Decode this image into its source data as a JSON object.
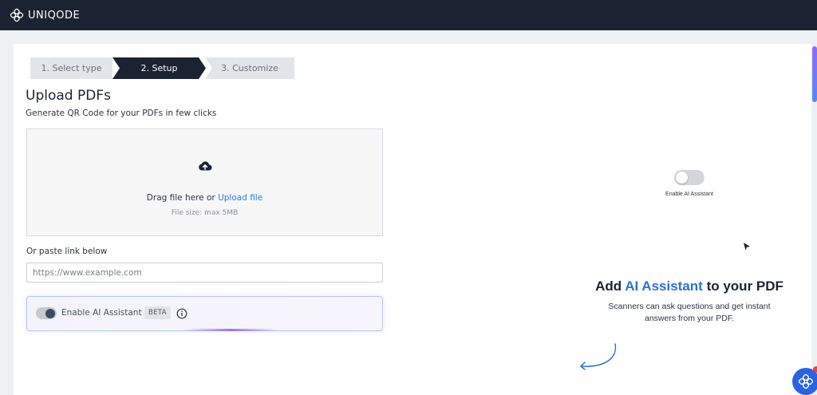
{
  "app": {
    "brand": "UNIQODE"
  },
  "stepper": {
    "steps": [
      {
        "label": "1. Select type",
        "state": "done"
      },
      {
        "label": "2. Setup",
        "state": "active"
      },
      {
        "label": "3. Customize",
        "state": "upcoming"
      }
    ]
  },
  "main": {
    "title": "Upload PDFs",
    "subtitle": "Generate QR Code for your PDFs in few clicks",
    "dropzone": {
      "icon": "cloud-upload-icon",
      "drag_text": "Drag file here or",
      "upload_link": "Upload file",
      "size_hint": "File size: max 5MB"
    },
    "paste": {
      "label": "Or paste link below",
      "placeholder": "https://www.example.com",
      "value": ""
    },
    "ai_assistant": {
      "label": "Enable AI Assistant",
      "badge": "BETA",
      "enabled": false
    }
  },
  "preview": {
    "toggle_label": "Enable AI Assistant",
    "toggle_enabled": false,
    "headline_prefix": "Add",
    "headline_accent": "AI Assistant",
    "headline_suffix": "to your PDF",
    "description": "Scanners can ask questions and get instant answers from your PDF."
  },
  "colors": {
    "topbar": "#1b2232",
    "active_step": "#1b2232",
    "link": "#2f80d6",
    "accent_blue": "#2f6fd9",
    "chat_fab": "#2962e8"
  }
}
